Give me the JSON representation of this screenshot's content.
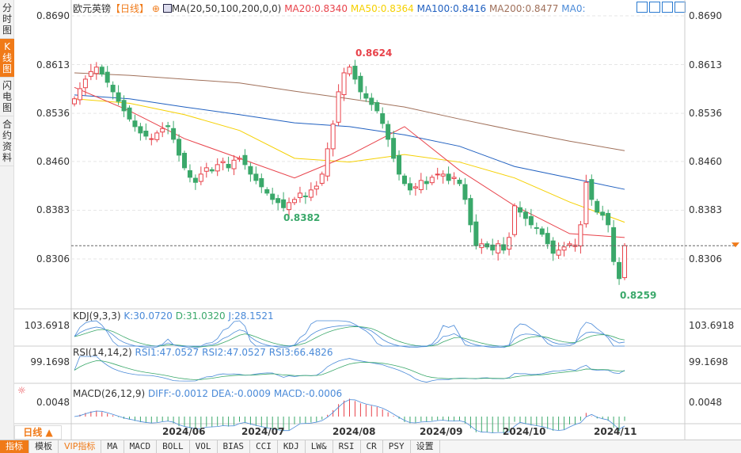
{
  "sidebar": {
    "tabs": [
      {
        "label": "分时图"
      },
      {
        "label": "K线图"
      },
      {
        "label": "闪电图"
      },
      {
        "label": "合约资料"
      }
    ]
  },
  "header": {
    "symbol": "欧元英镑",
    "period": "【日线】",
    "ma_params": "MA(20,50,100,200,0,0)",
    "ma20": "MA20:0.8340",
    "ma50": "MA50:0.8364",
    "ma100": "MA100:0.8416",
    "ma200": "MA200:0.8477",
    "ma0": "MA0:"
  },
  "price_axis": [
    "0.8690",
    "0.8613",
    "0.8536",
    "0.8460",
    "0.8383",
    "0.8306"
  ],
  "annotations": {
    "high": "0.8624",
    "low1": "0.8382",
    "low2": "0.8259"
  },
  "kdj": {
    "label": "KDJ(9,3,3)",
    "k": "K:30.0720",
    "d": "D:31.0320",
    "j": "J:28.1521",
    "axis": "103.6918"
  },
  "rsi": {
    "label": "RSI(14,14,2)",
    "r1": "RSI1:47.0527",
    "r2": "RSI2:47.0527",
    "r3": "RSI3:66.4826",
    "axis": "99.1698"
  },
  "macd": {
    "label": "MACD(26,12,9)",
    "diff": "DIFF:-0.0012",
    "dea": "DEA:-0.0009",
    "macd": "MACD:-0.0006",
    "axis": "0.0048"
  },
  "period_selector": "日线 ▲",
  "dates": [
    "2024/06",
    "2024/07",
    "2024/08",
    "2024/09",
    "2024/10",
    "2024/11"
  ],
  "toolbar": [
    "指标",
    "模板",
    "VIP指标",
    "MA",
    "MACD",
    "BOLL",
    "VOL",
    "BIAS",
    "CCI",
    "KDJ",
    "LW&",
    "RSI",
    "CR",
    "PSY",
    "设置"
  ],
  "colors": {
    "up": "#e8424a",
    "down": "#3aa86a",
    "ma20": "#e8424a",
    "ma50": "#f5d000",
    "ma100": "#2060c0",
    "ma200": "#a0705a",
    "accent": "#f07a18"
  },
  "chart_data": {
    "type": "candlestick",
    "title": "欧元英镑 日线",
    "ylim": [
      0.8245,
      0.87
    ],
    "closes": [
      0.8559,
      0.8575,
      0.859,
      0.8602,
      0.8609,
      0.8598,
      0.8585,
      0.857,
      0.8555,
      0.854,
      0.8527,
      0.8515,
      0.8505,
      0.85,
      0.8496,
      0.8505,
      0.8512,
      0.8515,
      0.8495,
      0.847,
      0.845,
      0.8435,
      0.8427,
      0.844,
      0.845,
      0.8445,
      0.8455,
      0.846,
      0.845,
      0.8462,
      0.8465,
      0.8455,
      0.844,
      0.843,
      0.842,
      0.841,
      0.84,
      0.8395,
      0.8387,
      0.8395,
      0.84,
      0.841,
      0.8405,
      0.8415,
      0.8421,
      0.844,
      0.848,
      0.8519,
      0.857,
      0.86,
      0.8609,
      0.859,
      0.857,
      0.856,
      0.855,
      0.854,
      0.852,
      0.8495,
      0.8465,
      0.844,
      0.8425,
      0.8415,
      0.842,
      0.843,
      0.8425,
      0.8435,
      0.844,
      0.844,
      0.843,
      0.8435,
      0.8425,
      0.84,
      0.836,
      0.8327,
      0.833,
      0.8325,
      0.832,
      0.833,
      0.832,
      0.834,
      0.839,
      0.838,
      0.837,
      0.836,
      0.8355,
      0.8345,
      0.833,
      0.8315,
      0.832,
      0.8325,
      0.833,
      0.8328,
      0.836,
      0.8427,
      0.84,
      0.838,
      0.8375,
      0.836,
      0.8302,
      0.8275,
      0.8327
    ],
    "ma_every10": {
      "MA20": [
        0.8577,
        0.854,
        0.8496,
        0.8465,
        0.8434,
        0.847,
        0.8515,
        0.8446,
        0.839,
        0.8346,
        0.834
      ],
      "MA50": [
        0.8559,
        0.8552,
        0.8534,
        0.8509,
        0.8465,
        0.8459,
        0.8471,
        0.8459,
        0.8434,
        0.8396,
        0.8364
      ],
      "MA100": [
        0.8565,
        0.8559,
        0.8546,
        0.8534,
        0.8521,
        0.8515,
        0.8502,
        0.8484,
        0.8452,
        0.8434,
        0.8416
      ],
      "MA200": [
        0.86,
        0.8596,
        0.859,
        0.8584,
        0.8571,
        0.8559,
        0.8546,
        0.8527,
        0.8509,
        0.8492,
        0.8477
      ]
    },
    "current_price": 0.8327
  }
}
